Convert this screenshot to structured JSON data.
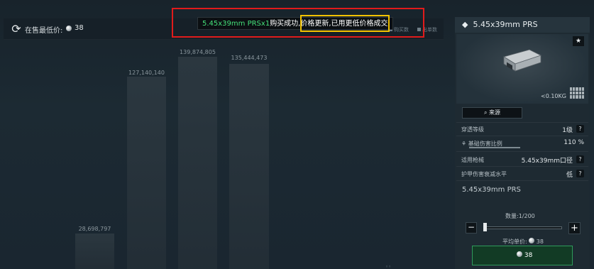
{
  "market": {
    "lowest_price_label": "在售最低价:",
    "lowest_price_value": "38",
    "legend_buy": "购买数",
    "legend_sell": "出单数",
    "bars": [
      {
        "label": "28,698,797",
        "value": 28698797
      },
      {
        "label": "127,140,140",
        "value": 127140140
      },
      {
        "label": "139,874,805",
        "value": 139874805
      },
      {
        "label": "135,444,473",
        "value": 135444473
      }
    ]
  },
  "notification": {
    "item_text": "5.45x39mm PRSx1",
    "success_text": "购买成功,",
    "highlight_text": "价格更新,已用更低价格成交"
  },
  "item_panel": {
    "title": "5.45x39mm PRS",
    "weight": "<0.10KG",
    "source_button": "来源",
    "stats": [
      {
        "label": "穿透等级",
        "value": "1级"
      },
      {
        "label": "基础伤害比例",
        "value": "110 %"
      },
      {
        "label": "适用枪械",
        "value": "5.45x39mm口径"
      },
      {
        "label": "护甲伤害衰减水平",
        "value": "低"
      }
    ],
    "description": "5.45x39mm PRS",
    "quantity_label": "数量:1/200",
    "average_price_label": "平均单价:",
    "average_price_value": "38",
    "buy_button_price": "38"
  },
  "colors": {
    "notification_border": "#e01b1b",
    "highlight_border": "#f2c200",
    "success_green": "#45e07a",
    "buy_button": "#123b25"
  }
}
